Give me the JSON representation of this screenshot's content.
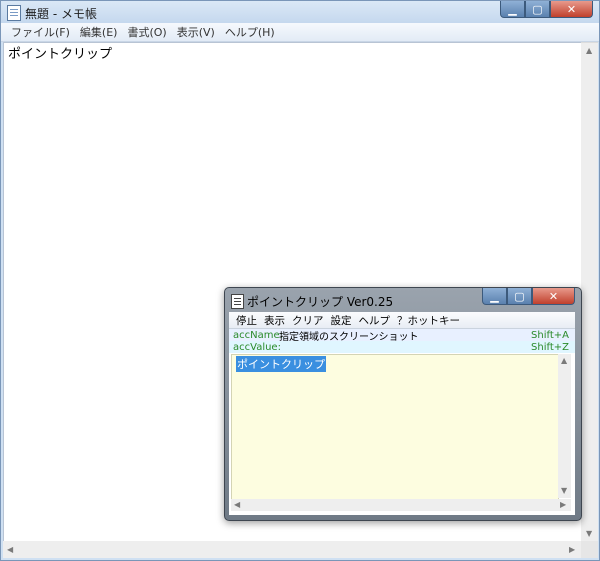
{
  "notepad": {
    "title": "無題 - メモ帳",
    "menu": [
      "ファイル(F)",
      "編集(E)",
      "書式(O)",
      "表示(V)",
      "ヘルプ(H)"
    ],
    "content": "ポイントクリップ"
  },
  "pointclip": {
    "title": "ポイントクリップ Ver0.25",
    "menu": [
      "停止",
      "表示",
      "クリア",
      "設定",
      "ヘルプ",
      "？ホットキー"
    ],
    "acc_name": {
      "label": "accName:",
      "value": "指定領域のスクリーンショット",
      "hotkey": "Shift+A"
    },
    "acc_value": {
      "label": "accValue:",
      "value": "",
      "hotkey": "Shift+Z"
    },
    "selected_text": "ポイントクリップ"
  }
}
